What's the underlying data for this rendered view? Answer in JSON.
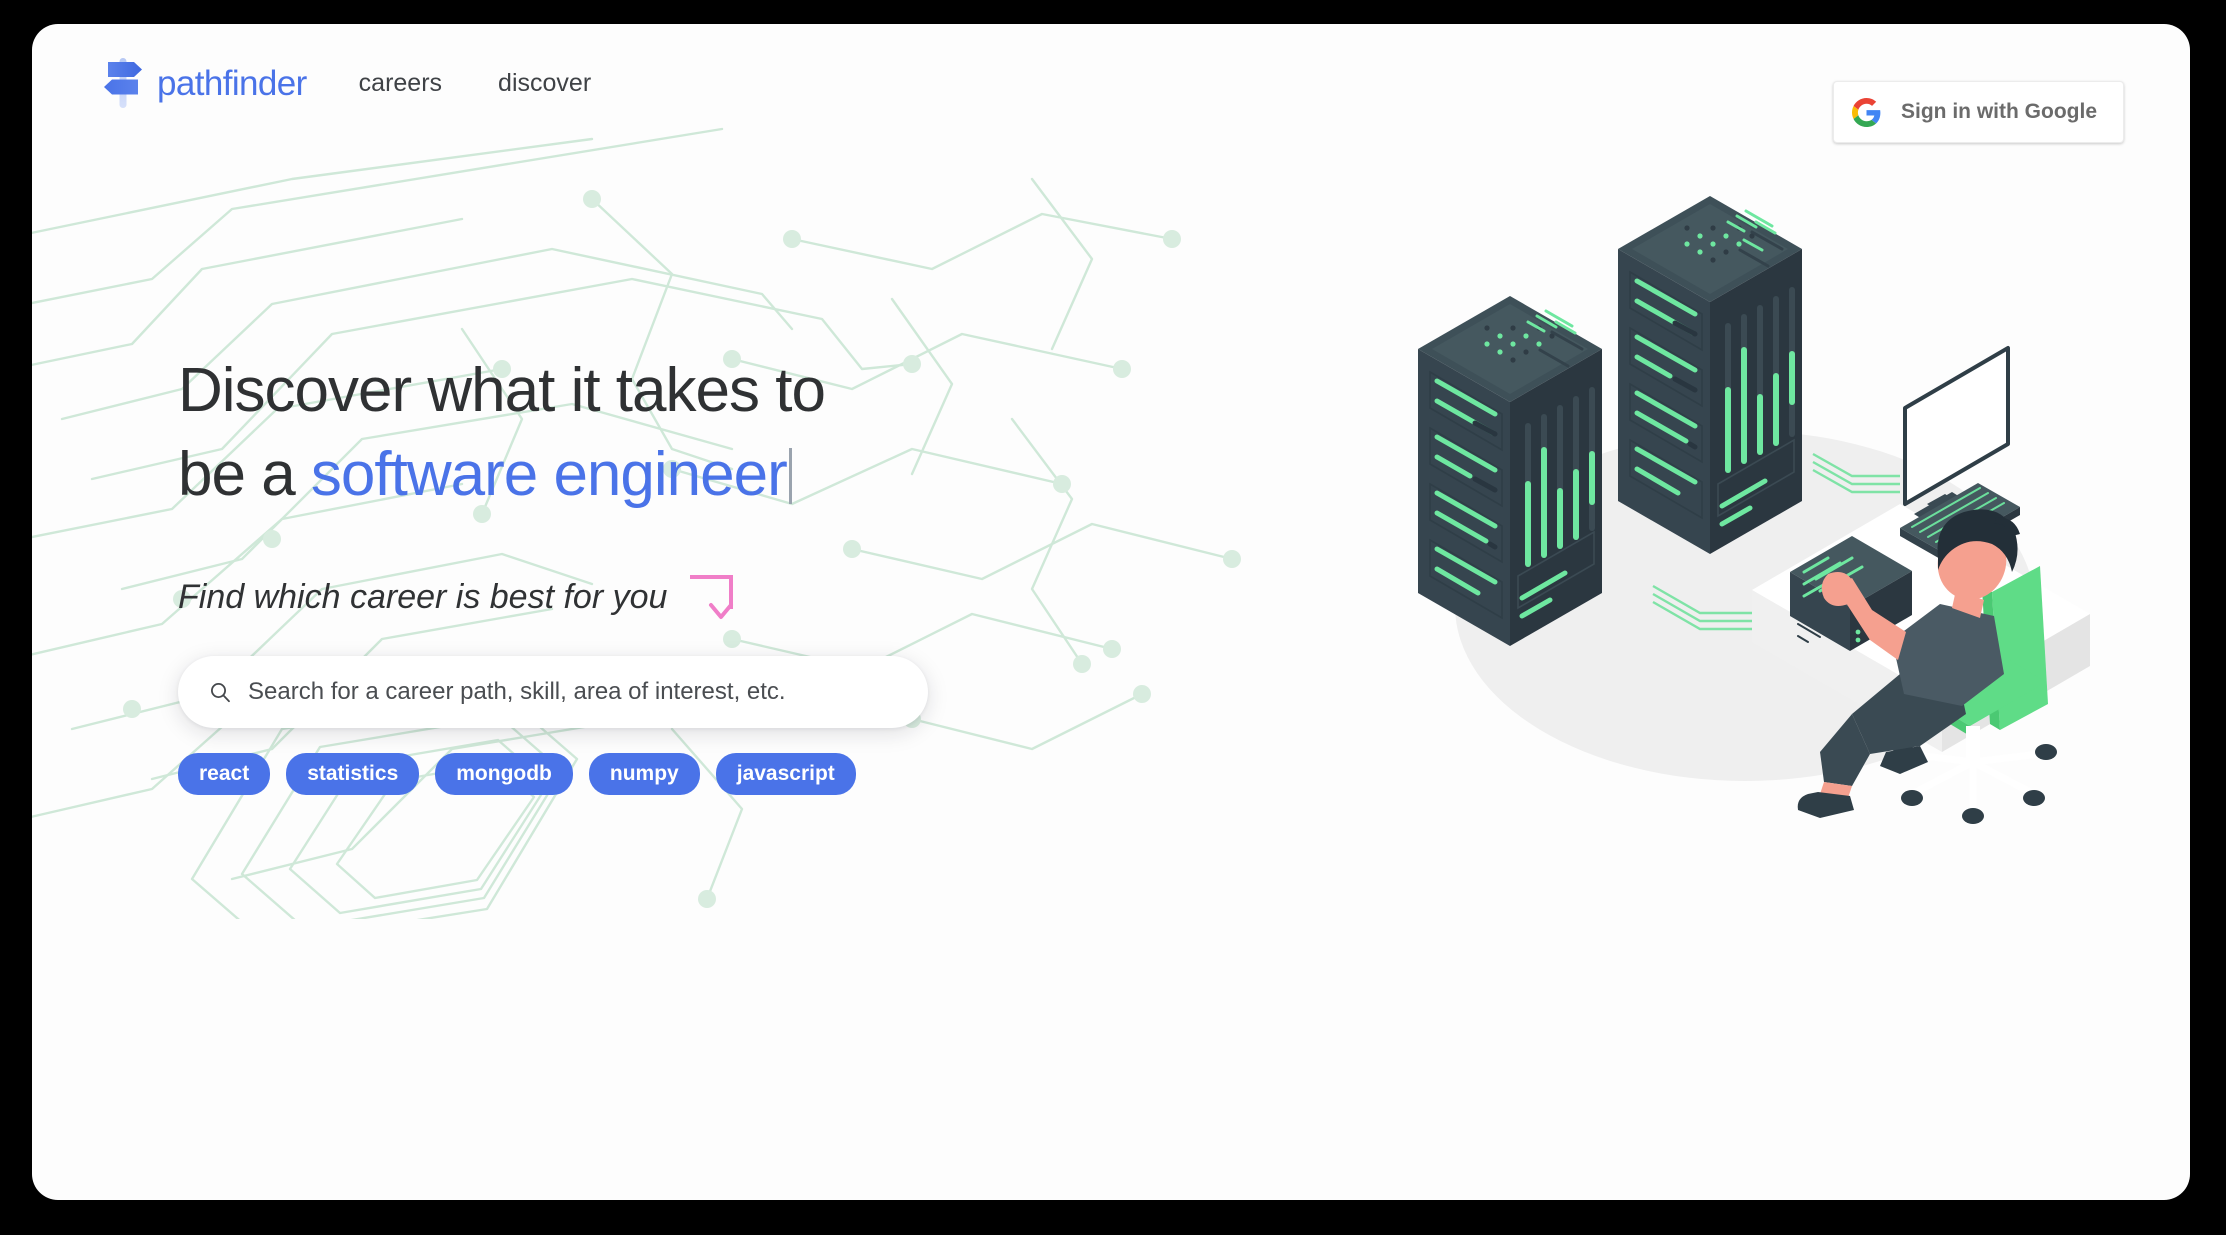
{
  "brand": {
    "name": "pathfinder",
    "logo_icon": "signpost-icon",
    "color": "#4a73e8"
  },
  "nav": {
    "links": [
      {
        "label": "careers"
      },
      {
        "label": "discover"
      }
    ]
  },
  "auth": {
    "google_signin_label": "Sign in with Google",
    "google_icon": "google-g-icon"
  },
  "hero": {
    "headline_line1": "Discover what it takes to",
    "headline_line2_prefix": "be a ",
    "headline_line2_accent": "software engineer",
    "subline": "Find which career is best for you",
    "arrow_icon": "arrow-down-bend-icon",
    "arrow_color": "#f07ec8",
    "accent_color": "#4a73e8"
  },
  "search": {
    "icon": "search-icon",
    "placeholder": "Search for a career path, skill, area of interest, etc.",
    "value": ""
  },
  "tags": [
    {
      "label": "react"
    },
    {
      "label": "statistics"
    },
    {
      "label": "mongodb"
    },
    {
      "label": "numpy"
    },
    {
      "label": "javascript"
    }
  ],
  "illustration": {
    "name": "server-room-developer-illustration",
    "palette": {
      "rack_dark": "#2b3640",
      "rack_mid": "#36454f",
      "rack_light": "#3f5159",
      "led_green": "#6ee7a0",
      "chair_green": "#5fdc87",
      "skin": "#f5a08f",
      "shadow": "#efefef"
    }
  },
  "background": {
    "page": "#fdfdfd",
    "outside": "#000000",
    "circuit_trace": "#cfe8d8"
  }
}
